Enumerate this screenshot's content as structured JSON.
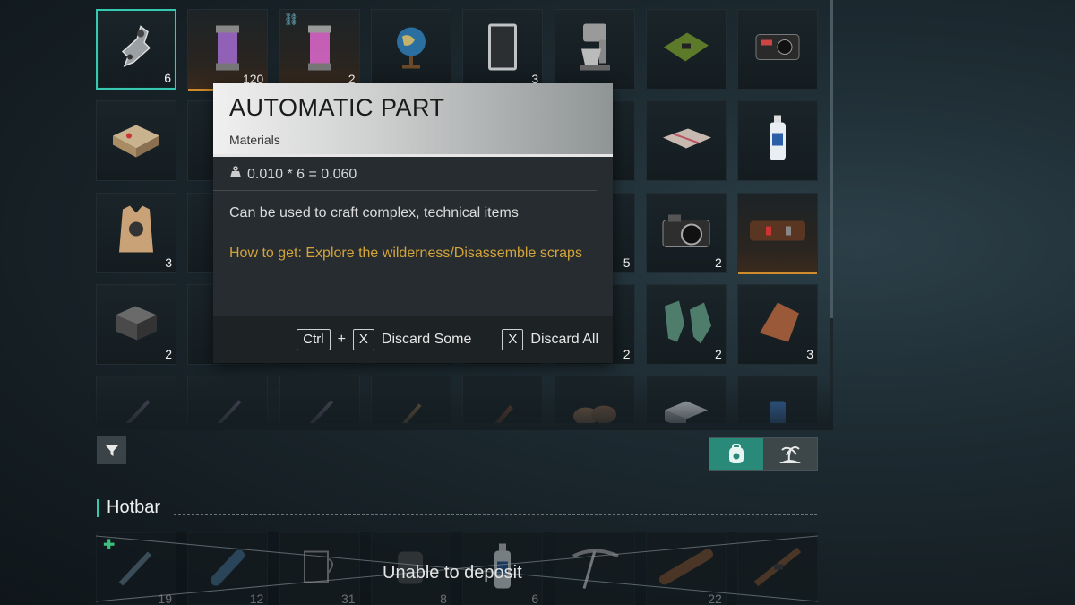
{
  "inventory": {
    "rows": [
      [
        {
          "icon": "automatic-part-icon",
          "count": "6",
          "selected": true
        },
        {
          "icon": "canister-icon",
          "count": "120",
          "orange": true
        },
        {
          "icon": "pink-canister-icon",
          "count": "2",
          "orange": true,
          "linked": true
        },
        {
          "icon": "globe-icon",
          "count": ""
        },
        {
          "icon": "tablet-icon",
          "count": "3"
        },
        {
          "icon": "mixer-icon",
          "count": ""
        },
        {
          "icon": "circuit-board-icon",
          "count": ""
        },
        {
          "icon": "dashcam-icon",
          "count": ""
        }
      ],
      [
        {
          "icon": "toolbox-icon",
          "count": ""
        },
        {
          "icon": "hidden-item-icon",
          "count": ""
        },
        {
          "icon": "hidden-item-icon",
          "count": ""
        },
        {
          "icon": "hidden-item-icon",
          "count": ""
        },
        {
          "icon": "hidden-item-icon",
          "count": ""
        },
        {
          "icon": "hidden-item-icon",
          "count": ""
        },
        {
          "icon": "fabric-sheet-icon",
          "count": ""
        },
        {
          "icon": "bottle-icon",
          "count": ""
        }
      ],
      [
        {
          "icon": "vest-icon",
          "count": "3"
        },
        {
          "icon": "hidden-item-icon",
          "count": ""
        },
        {
          "icon": "hidden-item-icon",
          "count": ""
        },
        {
          "icon": "hidden-item-icon",
          "count": ""
        },
        {
          "icon": "hidden-item-icon",
          "count": ""
        },
        {
          "icon": "hidden-item-icon",
          "count": "5"
        },
        {
          "icon": "camera-icon",
          "count": "2"
        },
        {
          "icon": "leather-case-icon",
          "count": "",
          "orange": true
        }
      ],
      [
        {
          "icon": "metal-box-icon",
          "count": "2"
        },
        {
          "icon": "hidden-item-icon",
          "count": ""
        },
        {
          "icon": "hidden-item-icon",
          "count": ""
        },
        {
          "icon": "hidden-item-icon",
          "count": ""
        },
        {
          "icon": "hidden-item-icon",
          "count": ""
        },
        {
          "icon": "hidden-item-icon",
          "count": "2"
        },
        {
          "icon": "gloves-icon",
          "count": "2"
        },
        {
          "icon": "leather-icon",
          "count": "3"
        }
      ],
      [
        {
          "icon": "pen-icon",
          "count": ""
        },
        {
          "icon": "pen-icon",
          "count": ""
        },
        {
          "icon": "pen-icon",
          "count": ""
        },
        {
          "icon": "stick-icon",
          "count": ""
        },
        {
          "icon": "tool-icon",
          "count": ""
        },
        {
          "icon": "rocks-icon",
          "count": ""
        },
        {
          "icon": "crate-icon",
          "count": ""
        },
        {
          "icon": "can-icon",
          "count": ""
        }
      ]
    ]
  },
  "tooltip": {
    "title": "AUTOMATIC PART",
    "category": "Materials",
    "weight": "0.010 * 6 = 0.060",
    "description": "Can be used to craft complex, technical items",
    "how_to_get": "How to get: Explore the wilderness/Disassemble scraps",
    "key_ctrl": "Ctrl",
    "plus": "+",
    "key_x": "X",
    "discard_some": "Discard Some",
    "discard_all": "Discard All"
  },
  "hotbar": {
    "title": "Hotbar",
    "unable_text": "Unable to deposit",
    "slots": [
      {
        "icon": "syringe-icon",
        "count": "19"
      },
      {
        "icon": "capsule-icon",
        "count": "12"
      },
      {
        "icon": "mug-icon",
        "count": "31"
      },
      {
        "icon": "jar-icon",
        "count": "8"
      },
      {
        "icon": "bottle-icon",
        "count": "6"
      },
      {
        "icon": "pickaxe-icon",
        "count": ""
      },
      {
        "icon": "wood-log-icon",
        "count": "22"
      },
      {
        "icon": "rifle-icon",
        "count": ""
      }
    ]
  },
  "colors": {
    "accent": "#38c7b0",
    "tooltip_gold": "#d4a43a",
    "orange_rarity": "#d08b2c"
  }
}
